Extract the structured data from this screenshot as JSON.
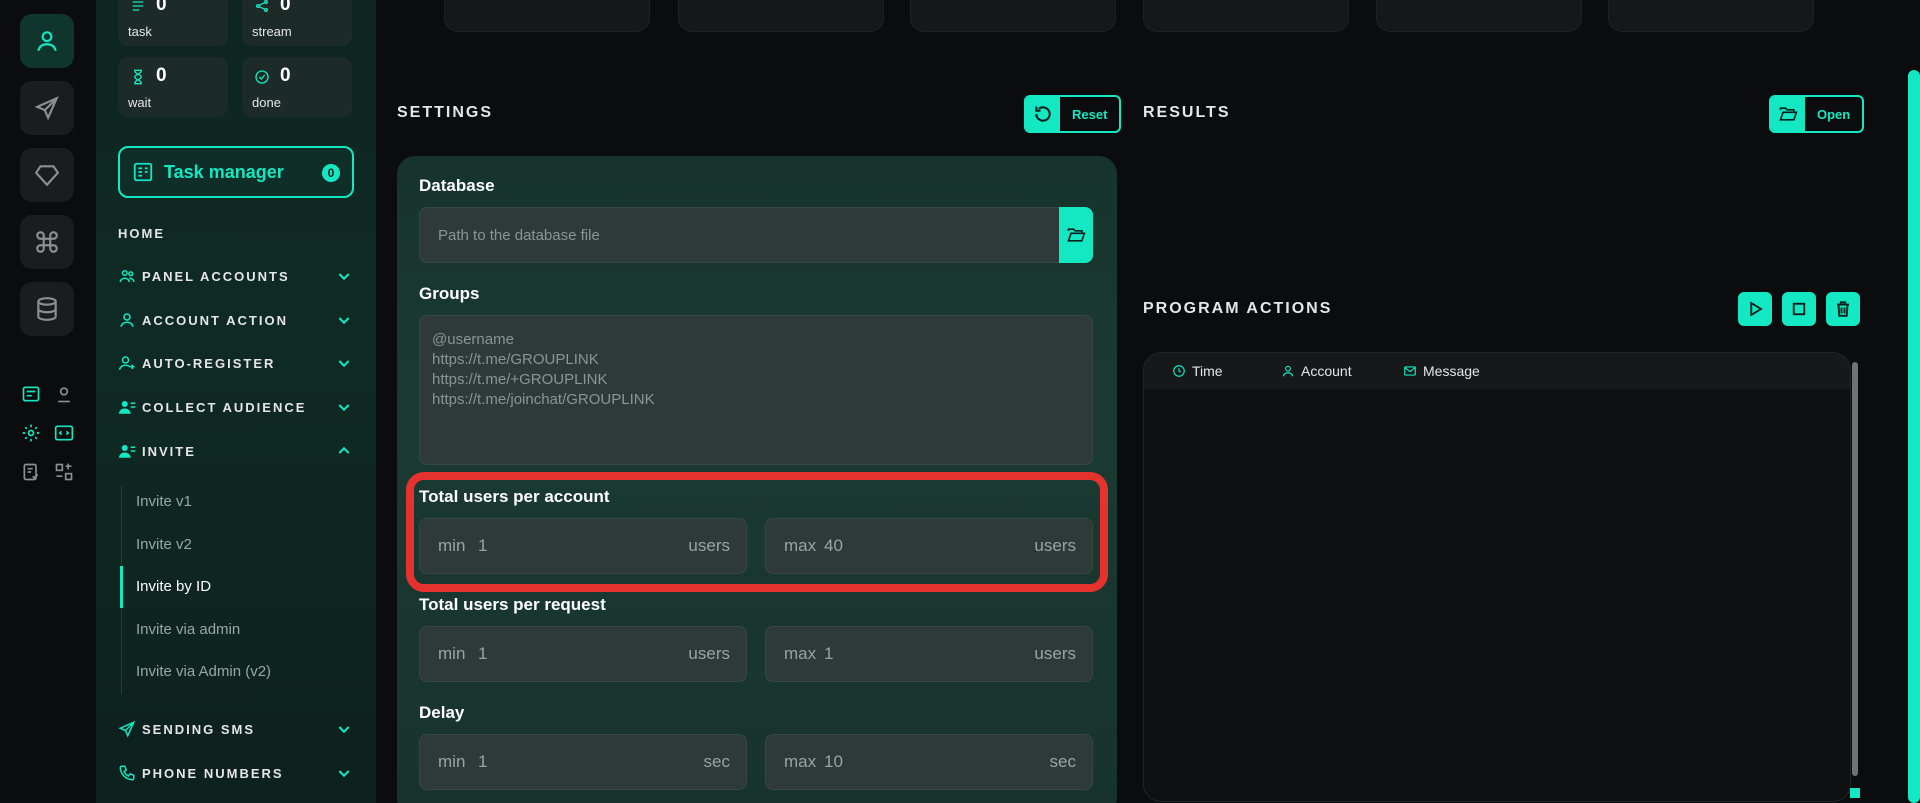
{
  "stats": [
    {
      "value": "0",
      "label": "task"
    },
    {
      "value": "0",
      "label": "stream"
    },
    {
      "value": "0",
      "label": "wait"
    },
    {
      "value": "0",
      "label": "done"
    }
  ],
  "task_manager": {
    "label": "Task manager",
    "count": "0"
  },
  "nav": {
    "home": "HOME",
    "panel_accounts": "PANEL ACCOUNTS",
    "account_action": "ACCOUNT ACTION",
    "auto_register": "AUTO-REGISTER",
    "collect_audience": "COLLECT AUDIENCE",
    "invite": "INVITE",
    "invite_items": [
      "Invite v1",
      "Invite v2",
      "Invite by ID",
      "Invite via admin",
      "Invite via Admin (v2)"
    ],
    "sending_sms": "SENDING SMS",
    "phone_numbers": "PHONE NUMBERS"
  },
  "settings": {
    "title": "SETTINGS",
    "reset": "Reset",
    "database_label": "Database",
    "database_placeholder": "Path to the database file",
    "groups_label": "Groups",
    "groups_placeholder": [
      "@username",
      "https://t.me/GROUPLINK",
      "https://t.me/+GROUPLINK",
      "https://t.me/joinchat/GROUPLINK"
    ],
    "total_users_account": {
      "label": "Total users per account",
      "min_prefix": "min",
      "min": "1",
      "max_prefix": "max",
      "max": "40",
      "unit": "users"
    },
    "total_users_request": {
      "label": "Total users per request",
      "min_prefix": "min",
      "min": "1",
      "max_prefix": "max",
      "max": "1",
      "unit": "users"
    },
    "delay": {
      "label": "Delay",
      "min_prefix": "min",
      "min": "1",
      "max_prefix": "max",
      "max": "10",
      "unit": "sec"
    }
  },
  "results": {
    "title": "RESULTS",
    "open": "Open"
  },
  "program_actions": {
    "title": "PROGRAM ACTIONS",
    "columns": [
      "Time",
      "Account",
      "Message"
    ]
  },
  "colors": {
    "accent": "#14e8c2",
    "highlight": "#e5322f"
  }
}
